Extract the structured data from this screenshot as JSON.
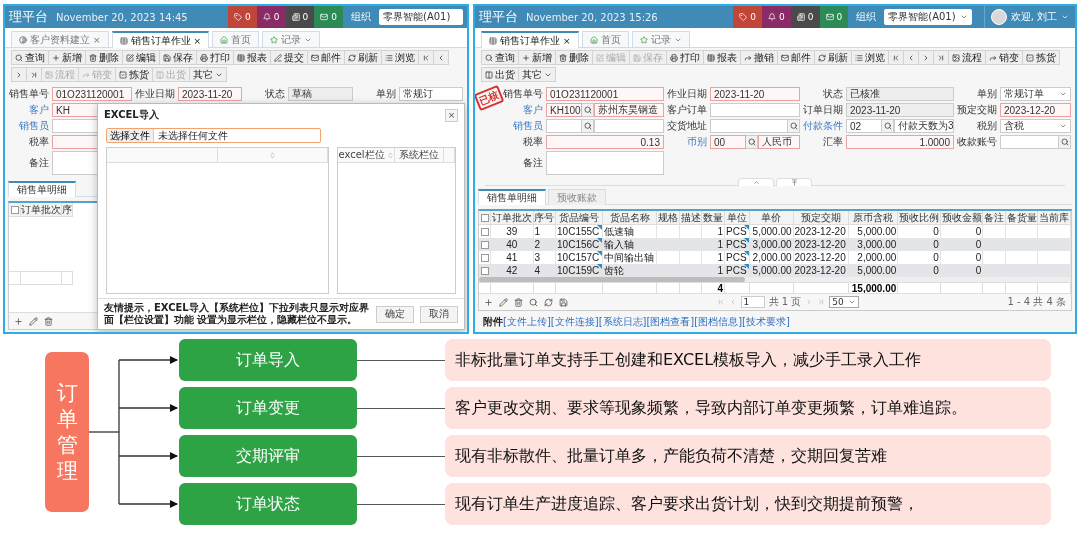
{
  "screens": [
    {
      "kind": "import",
      "title": "理平台",
      "datetime": "November 20, 2023 14:45",
      "badges": [
        {
          "count": "0",
          "color": "#c0463a"
        },
        {
          "count": "0",
          "color": "#8a2a66"
        },
        {
          "count": "0",
          "color": "#4a4a4a"
        },
        {
          "count": "0",
          "color": "#2c8a55"
        }
      ],
      "org_label": "组织",
      "org": {
        "value": "零界智能(A01)",
        "dropdown": false
      },
      "tabs": [
        {
          "label": "客户资料建立",
          "kind": "form",
          "close": "×",
          "dropdown": false,
          "selected": false
        },
        {
          "label": "销售订单作业",
          "kind": "table",
          "close": "×",
          "dropdown": false,
          "selected": true
        },
        {
          "label": "首页",
          "kind": "home",
          "dropdown": false,
          "selected": false
        },
        {
          "label": "记录",
          "kind": "star",
          "dropdown": true,
          "selected": false
        }
      ],
      "toolbar": [
        {
          "kind": "button",
          "label": "查询",
          "disabled": false
        },
        {
          "kind": "button",
          "label": "新增",
          "disabled": false
        },
        {
          "kind": "button",
          "label": "删除",
          "disabled": false
        },
        {
          "kind": "button",
          "label": "编辑",
          "disabled": false
        },
        {
          "kind": "button",
          "label": "保存",
          "disabled": false
        },
        {
          "kind": "button",
          "label": "打印",
          "disabled": false
        },
        {
          "kind": "button",
          "label": "报表",
          "disabled": false
        },
        {
          "kind": "button",
          "label": "提交",
          "disabled": false
        },
        {
          "kind": "button",
          "label": "邮件",
          "disabled": false
        },
        {
          "kind": "button",
          "label": "刷新",
          "disabled": false
        },
        {
          "kind": "button",
          "label": "浏览",
          "disabled": false
        },
        {
          "kind": "nav",
          "disabled": false
        },
        {
          "kind": "nav",
          "disabled": false
        },
        {
          "kind": "nav",
          "disabled": false
        },
        {
          "kind": "nav",
          "disabled": false
        },
        {
          "kind": "button",
          "label": "流程",
          "disabled": true
        },
        {
          "kind": "button",
          "label": "销变",
          "disabled": true
        },
        {
          "kind": "button",
          "label": "拣货",
          "disabled": false
        },
        {
          "kind": "button",
          "label": "出货",
          "disabled": true
        },
        {
          "kind": "menu",
          "label": "其它",
          "disabled": false
        }
      ],
      "form": [
        [
          {
            "label": "销售单号",
            "link": false,
            "kind": "text",
            "value": "01O231120001",
            "required": true,
            "readonly": false
          },
          {
            "label": "作业日期",
            "link": false,
            "kind": "text",
            "value": "2023-11-20",
            "required": true,
            "readonly": false
          },
          {
            "label": "状态",
            "link": false,
            "kind": "text",
            "value": "草稿",
            "required": false,
            "readonly": true
          },
          {
            "label": "单别",
            "link": false,
            "kind": "text",
            "value": "常规订",
            "required": false,
            "readonly": false
          }
        ],
        [
          {
            "label": "客户",
            "link": true,
            "kind": "text",
            "value": "KH",
            "required": true,
            "readonly": false
          }
        ],
        [
          {
            "label": "销售员",
            "link": true,
            "kind": "text",
            "required": false,
            "readonly": false
          }
        ],
        [
          {
            "label": "税率",
            "link": false,
            "kind": "text",
            "required": true,
            "readonly": false
          }
        ],
        [
          {
            "label": "备注",
            "link": false,
            "kind": "textarea",
            "required": false,
            "readonly": false
          }
        ]
      ],
      "detail_tabs": [
        {
          "label": "销售单明细",
          "selected": true
        }
      ],
      "grid": {
        "select_all": false,
        "columns": [
          {
            "label": "订单批次"
          },
          {
            "label": "序"
          }
        ]
      },
      "dialog": {
        "title": "EXCEL导入",
        "close": "×",
        "file_button": "选择文件",
        "file_text": "未选择任何文件",
        "map_columns": [
          "excel栏位",
          "系统栏位"
        ],
        "note": "友情提示，EXCEL导入【系统栏位】下拉列表只显示对应界面【栏位设置】功能 设置为显示栏位，隐藏栏位不显示。",
        "buttons": [
          "确定",
          "取消"
        ]
      }
    },
    {
      "kind": "order",
      "title": "理平台",
      "datetime": "November 20, 2023 15:26",
      "badges": [
        {
          "count": "0",
          "color": "#c0463a"
        },
        {
          "count": "0",
          "color": "#8a2a66"
        },
        {
          "count": "0",
          "color": "#4a4a4a"
        },
        {
          "count": "0",
          "color": "#2c8a55"
        }
      ],
      "org_label": "组织",
      "org": {
        "value": "零界智能(A01)",
        "dropdown": true
      },
      "user": "欢迎, 刘工",
      "tabs": [
        {
          "label": "销售订单作业",
          "kind": "table",
          "close": "×",
          "dropdown": false,
          "selected": true
        },
        {
          "label": "首页",
          "kind": "home",
          "dropdown": false,
          "selected": false
        },
        {
          "label": "记录",
          "kind": "star",
          "dropdown": true,
          "selected": false
        }
      ],
      "toolbar": [
        {
          "kind": "button",
          "label": "查询",
          "disabled": false
        },
        {
          "kind": "button",
          "label": "新增",
          "disabled": false
        },
        {
          "kind": "button",
          "label": "删除",
          "disabled": false
        },
        {
          "kind": "button",
          "label": "编辑",
          "disabled": true
        },
        {
          "kind": "button",
          "label": "保存",
          "disabled": true
        },
        {
          "kind": "button",
          "label": "打印",
          "disabled": false
        },
        {
          "kind": "button",
          "label": "报表",
          "disabled": false
        },
        {
          "kind": "button",
          "label": "撤销",
          "disabled": false
        },
        {
          "kind": "button",
          "label": "邮件",
          "disabled": false
        },
        {
          "kind": "button",
          "label": "刷新",
          "disabled": false
        },
        {
          "kind": "button",
          "label": "浏览",
          "disabled": false
        },
        {
          "kind": "nav",
          "disabled": false
        },
        {
          "kind": "nav",
          "disabled": false
        },
        {
          "kind": "nav",
          "disabled": false
        },
        {
          "kind": "nav",
          "disabled": false
        },
        {
          "kind": "button",
          "label": "流程",
          "disabled": false
        },
        {
          "kind": "button",
          "label": "销变",
          "disabled": false
        },
        {
          "kind": "button",
          "label": "拣货",
          "disabled": false
        },
        {
          "kind": "button",
          "label": "出货",
          "disabled": false
        },
        {
          "kind": "menu",
          "label": "其它",
          "disabled": false
        }
      ],
      "stamp": "已核",
      "form": [
        [
          {
            "label": "销售单号",
            "link": false,
            "kind": "text",
            "value": "01O231120001",
            "required": true,
            "readonly": false
          },
          {
            "label": "作业日期",
            "link": false,
            "kind": "text",
            "value": "2023-11-20",
            "required": true,
            "readonly": false
          },
          {
            "label": "状态",
            "link": false,
            "kind": "text",
            "value": "已核准",
            "required": false,
            "readonly": true
          },
          {
            "label": "单别",
            "link": false,
            "kind": "select",
            "value": "常规订单",
            "required": false,
            "readonly": false
          }
        ],
        [
          {
            "label": "客户",
            "link": true,
            "kind": "lookup",
            "value": "KH100",
            "extra": "苏州东昊钢造",
            "required": true,
            "readonly": false
          },
          {
            "label": "客户订单",
            "link": false,
            "kind": "text",
            "required": false,
            "readonly": false
          },
          {
            "label": "订单日期",
            "link": false,
            "kind": "text",
            "value": "2023-11-20",
            "required": false,
            "readonly": true
          },
          {
            "label": "预定交期",
            "link": false,
            "kind": "text",
            "value": "2023-12-20",
            "required": true,
            "readonly": false
          }
        ],
        [
          {
            "label": "销售员",
            "link": true,
            "kind": "lookup",
            "required": false,
            "readonly": false
          },
          {
            "label": "交货地址",
            "link": false,
            "kind": "search",
            "required": false,
            "readonly": false
          },
          {
            "label": "付款条件",
            "link": true,
            "kind": "lookup",
            "value": "02",
            "extra": "付款天数为3",
            "required": false,
            "readonly": false
          },
          {
            "label": "税别",
            "link": false,
            "kind": "select",
            "value": "含税",
            "required": false,
            "readonly": false
          }
        ],
        [
          {
            "label": "税率",
            "link": false,
            "kind": "number",
            "value": "0.13",
            "required": true,
            "readonly": false
          },
          {
            "label": "币别",
            "link": true,
            "kind": "lookup",
            "value": "00",
            "extra": "人民币",
            "required": true,
            "readonly": false
          },
          {
            "label": "汇率",
            "link": false,
            "kind": "number",
            "value": "1.0000",
            "required": true,
            "readonly": false
          },
          {
            "label": "收款账号",
            "link": false,
            "kind": "search",
            "required": false,
            "readonly": false
          }
        ],
        [
          {
            "label": "备注",
            "link": false,
            "kind": "textarea",
            "required": false,
            "readonly": false
          }
        ]
      ],
      "detail_tabs": [
        {
          "label": "销售单明细",
          "selected": true
        },
        {
          "label": "预收账款",
          "selected": false
        }
      ],
      "grid": {
        "select_all": false,
        "columns": [
          {
            "label": "订单批次",
            "kind": "center",
            "marked": false
          },
          {
            "label": "序号",
            "kind": "text",
            "marked": false
          },
          {
            "label": "货品编号",
            "kind": "text",
            "marked": true
          },
          {
            "label": "货品名称",
            "kind": "text",
            "marked": false
          },
          {
            "label": "规格",
            "kind": "text",
            "marked": false
          },
          {
            "label": "描述",
            "kind": "text",
            "marked": false
          },
          {
            "label": "数量",
            "kind": "number",
            "marked": false,
            "total": "4"
          },
          {
            "label": "单位",
            "kind": "text",
            "marked": true
          },
          {
            "label": "单价",
            "kind": "number",
            "marked": false
          },
          {
            "label": "预定交期",
            "kind": "text",
            "marked": false
          },
          {
            "label": "原币含税",
            "kind": "number",
            "marked": false,
            "total": "15,000.00"
          },
          {
            "label": "预收比例",
            "kind": "number",
            "marked": false
          },
          {
            "label": "预收金额",
            "kind": "number",
            "marked": false
          },
          {
            "label": "备注",
            "kind": "text",
            "marked": false
          },
          {
            "label": "备货量",
            "kind": "text",
            "marked": false
          },
          {
            "label": "当前库",
            "kind": "text",
            "marked": false
          }
        ],
        "rows": [
          {
            "checked": false,
            "cells": [
              "39",
              "1",
              "10C155C",
              "低速轴",
              null,
              null,
              "1",
              "PCS",
              "5,000.00",
              "2023-12-20",
              "5,000.00",
              "0",
              "0",
              null,
              null,
              null
            ]
          },
          {
            "checked": false,
            "cells": [
              "40",
              "2",
              "10C156C",
              "输入轴",
              null,
              null,
              "1",
              "PCS",
              "3,000.00",
              "2023-12-20",
              "3,000.00",
              "0",
              "0",
              null,
              null,
              null
            ]
          },
          {
            "checked": false,
            "cells": [
              "41",
              "3",
              "10C157C",
              "中间输出轴",
              null,
              null,
              "1",
              "PCS",
              "2,000.00",
              "2023-12-20",
              "2,000.00",
              "0",
              "0",
              null,
              null,
              null
            ]
          },
          {
            "checked": false,
            "cells": [
              "42",
              "4",
              "10C159C",
              "齿轮",
              null,
              null,
              "1",
              "PCS",
              "5,000.00",
              "2023-12-20",
              "5,000.00",
              "0",
              "0",
              null,
              null,
              null
            ]
          }
        ]
      },
      "pager": {
        "page": "1",
        "pages": "共 1 页",
        "size": "50",
        "summary": "1 - 4  共 4 条"
      },
      "attachments": {
        "label": "附件",
        "links": [
          "[文件上传]",
          "[文件连接]",
          "[系统日志]",
          "[图档查看]",
          "[图档信息]",
          "[技术要求]"
        ]
      }
    }
  ],
  "diagram": {
    "root": "订单管理",
    "items": [
      {
        "title": "订单导入",
        "description": "非标批量订单支持手工创建和EXCEL模板导入，减少手工录入工作"
      },
      {
        "title": "订单变更",
        "description": "客户更改交期、要求等现象频繁，导致内部订单变更频繁，订单难追踪。"
      },
      {
        "title": "交期评审",
        "description": "现有非标散件、批量订单多，产能负荷不清楚，交期回复苦难"
      },
      {
        "title": "订单状态",
        "description": "现有订单生产进度追踪、客户要求出货计划，快到交期提前预警，"
      }
    ]
  }
}
